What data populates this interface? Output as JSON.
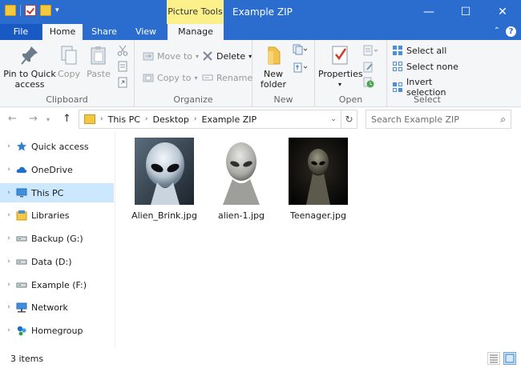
{
  "window": {
    "title": "Example ZIP",
    "context_tab": "Picture Tools",
    "controls": {
      "minimize": "—",
      "maximize": "☐",
      "close": "✕"
    }
  },
  "tabs": {
    "file": "File",
    "home": "Home",
    "share": "Share",
    "view": "View",
    "manage": "Manage"
  },
  "ribbon": {
    "clipboard": {
      "label": "Clipboard",
      "pin_line1": "Pin to Quick",
      "pin_line2": "access",
      "copy": "Copy",
      "paste": "Paste"
    },
    "organize": {
      "label": "Organize",
      "move_to": "Move to",
      "copy_to": "Copy to",
      "delete": "Delete",
      "rename": "Rename"
    },
    "new": {
      "label": "New",
      "new_folder_line1": "New",
      "new_folder_line2": "folder"
    },
    "open": {
      "label": "Open",
      "properties": "Properties"
    },
    "select": {
      "label": "Select",
      "select_all": "Select all",
      "select_none": "Select none",
      "invert_selection": "Invert selection"
    }
  },
  "address": {
    "crumbs": [
      "This PC",
      "Desktop",
      "Example ZIP"
    ],
    "search_placeholder": "Search Example ZIP"
  },
  "nav": {
    "items": [
      {
        "label": "Quick access",
        "icon": "star-icon"
      },
      {
        "label": "OneDrive",
        "icon": "cloud-icon"
      },
      {
        "label": "This PC",
        "icon": "computer-icon"
      },
      {
        "label": "Libraries",
        "icon": "library-icon"
      },
      {
        "label": "Backup (G:)",
        "icon": "drive-icon"
      },
      {
        "label": "Data (D:)",
        "icon": "drive-icon"
      },
      {
        "label": "Example (F:)",
        "icon": "drive-icon"
      },
      {
        "label": "Network",
        "icon": "network-icon"
      },
      {
        "label": "Homegroup",
        "icon": "homegroup-icon"
      }
    ],
    "selected": "This PC"
  },
  "files": [
    {
      "name": "Alien_Brink.jpg"
    },
    {
      "name": "alien-1.jpg"
    },
    {
      "name": "Teenager.jpg"
    }
  ],
  "status": {
    "count": "3 items"
  },
  "colors": {
    "titlebar": "#2b6ccf",
    "file_tab": "#1959c4",
    "context_tab": "#fcf08a",
    "selection": "#cce8ff"
  }
}
